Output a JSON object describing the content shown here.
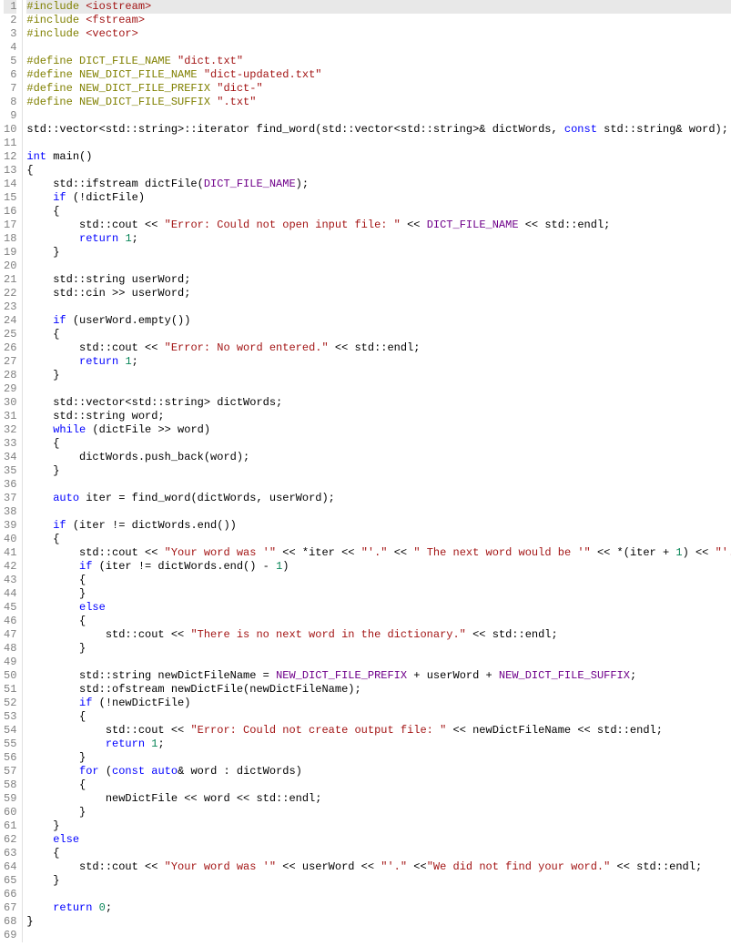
{
  "editor": {
    "highlighted_line": 1,
    "total_lines": 69,
    "lines": [
      {
        "n": 1,
        "tokens": [
          [
            "pp",
            "#include "
          ],
          [
            "str",
            "<iostream>"
          ]
        ]
      },
      {
        "n": 2,
        "tokens": [
          [
            "pp",
            "#include "
          ],
          [
            "str",
            "<fstream>"
          ]
        ]
      },
      {
        "n": 3,
        "tokens": [
          [
            "pp",
            "#include "
          ],
          [
            "str",
            "<vector>"
          ]
        ]
      },
      {
        "n": 4,
        "tokens": []
      },
      {
        "n": 5,
        "tokens": [
          [
            "pp",
            "#define DICT_FILE_NAME "
          ],
          [
            "str",
            "\"dict.txt\""
          ]
        ]
      },
      {
        "n": 6,
        "tokens": [
          [
            "pp",
            "#define NEW_DICT_FILE_NAME "
          ],
          [
            "str",
            "\"dict-updated.txt\""
          ]
        ]
      },
      {
        "n": 7,
        "tokens": [
          [
            "pp",
            "#define NEW_DICT_FILE_PREFIX "
          ],
          [
            "str",
            "\"dict-\""
          ]
        ]
      },
      {
        "n": 8,
        "tokens": [
          [
            "pp",
            "#define NEW_DICT_FILE_SUFFIX "
          ],
          [
            "str",
            "\".txt\""
          ]
        ]
      },
      {
        "n": 9,
        "tokens": []
      },
      {
        "n": 10,
        "tokens": [
          [
            "id",
            "std::vector<std::string>::iterator find_word(std::vector<std::string>& dictWords, "
          ],
          [
            "kw",
            "const"
          ],
          [
            "id",
            " std::string& word);"
          ]
        ]
      },
      {
        "n": 11,
        "tokens": []
      },
      {
        "n": 12,
        "tokens": [
          [
            "kw",
            "int"
          ],
          [
            "id",
            " main()"
          ]
        ]
      },
      {
        "n": 13,
        "tokens": [
          [
            "id",
            "{"
          ]
        ]
      },
      {
        "n": 14,
        "tokens": [
          [
            "id",
            "    std::ifstream dictFile("
          ],
          [
            "mac",
            "DICT_FILE_NAME"
          ],
          [
            "id",
            ");"
          ]
        ]
      },
      {
        "n": 15,
        "tokens": [
          [
            "id",
            "    "
          ],
          [
            "kw",
            "if"
          ],
          [
            "id",
            " (!dictFile)"
          ]
        ]
      },
      {
        "n": 16,
        "tokens": [
          [
            "id",
            "    {"
          ]
        ]
      },
      {
        "n": 17,
        "tokens": [
          [
            "id",
            "        std::cout << "
          ],
          [
            "str",
            "\"Error: Could not open input file: \""
          ],
          [
            "id",
            " << "
          ],
          [
            "mac",
            "DICT_FILE_NAME"
          ],
          [
            "id",
            " << std::endl;"
          ]
        ]
      },
      {
        "n": 18,
        "tokens": [
          [
            "id",
            "        "
          ],
          [
            "kw",
            "return"
          ],
          [
            "id",
            " "
          ],
          [
            "num",
            "1"
          ],
          [
            "id",
            ";"
          ]
        ]
      },
      {
        "n": 19,
        "tokens": [
          [
            "id",
            "    }"
          ]
        ]
      },
      {
        "n": 20,
        "tokens": []
      },
      {
        "n": 21,
        "tokens": [
          [
            "id",
            "    std::string userWord;"
          ]
        ]
      },
      {
        "n": 22,
        "tokens": [
          [
            "id",
            "    std::cin >> userWord;"
          ]
        ]
      },
      {
        "n": 23,
        "tokens": []
      },
      {
        "n": 24,
        "tokens": [
          [
            "id",
            "    "
          ],
          [
            "kw",
            "if"
          ],
          [
            "id",
            " (userWord.empty())"
          ]
        ]
      },
      {
        "n": 25,
        "tokens": [
          [
            "id",
            "    {"
          ]
        ]
      },
      {
        "n": 26,
        "tokens": [
          [
            "id",
            "        std::cout << "
          ],
          [
            "str",
            "\"Error: No word entered.\""
          ],
          [
            "id",
            " << std::endl;"
          ]
        ]
      },
      {
        "n": 27,
        "tokens": [
          [
            "id",
            "        "
          ],
          [
            "kw",
            "return"
          ],
          [
            "id",
            " "
          ],
          [
            "num",
            "1"
          ],
          [
            "id",
            ";"
          ]
        ]
      },
      {
        "n": 28,
        "tokens": [
          [
            "id",
            "    }"
          ]
        ]
      },
      {
        "n": 29,
        "tokens": []
      },
      {
        "n": 30,
        "tokens": [
          [
            "id",
            "    std::vector<std::string> dictWords;"
          ]
        ]
      },
      {
        "n": 31,
        "tokens": [
          [
            "id",
            "    std::string word;"
          ]
        ]
      },
      {
        "n": 32,
        "tokens": [
          [
            "id",
            "    "
          ],
          [
            "kw",
            "while"
          ],
          [
            "id",
            " (dictFile >> word)"
          ]
        ]
      },
      {
        "n": 33,
        "tokens": [
          [
            "id",
            "    {"
          ]
        ]
      },
      {
        "n": 34,
        "tokens": [
          [
            "id",
            "        dictWords.push_back(word);"
          ]
        ]
      },
      {
        "n": 35,
        "tokens": [
          [
            "id",
            "    }"
          ]
        ]
      },
      {
        "n": 36,
        "tokens": []
      },
      {
        "n": 37,
        "tokens": [
          [
            "id",
            "    "
          ],
          [
            "kw",
            "auto"
          ],
          [
            "id",
            " iter = find_word(dictWords, userWord);"
          ]
        ]
      },
      {
        "n": 38,
        "tokens": []
      },
      {
        "n": 39,
        "tokens": [
          [
            "id",
            "    "
          ],
          [
            "kw",
            "if"
          ],
          [
            "id",
            " (iter != dictWords.end())"
          ]
        ]
      },
      {
        "n": 40,
        "tokens": [
          [
            "id",
            "    {"
          ]
        ]
      },
      {
        "n": 41,
        "tokens": [
          [
            "id",
            "        std::cout << "
          ],
          [
            "str",
            "\"Your word was '\""
          ],
          [
            "id",
            " << *iter << "
          ],
          [
            "str",
            "\"'.\""
          ],
          [
            "id",
            " << "
          ],
          [
            "str",
            "\" The next word would be '\""
          ],
          [
            "id",
            " << *(iter + "
          ],
          [
            "num",
            "1"
          ],
          [
            "id",
            ") << "
          ],
          [
            "str",
            "\"'.\""
          ],
          [
            "id",
            "<< "
          ]
        ]
      },
      {
        "n": 42,
        "tokens": [
          [
            "id",
            "        "
          ],
          [
            "kw",
            "if"
          ],
          [
            "id",
            " (iter != dictWords.end() - "
          ],
          [
            "num",
            "1"
          ],
          [
            "id",
            ")"
          ]
        ]
      },
      {
        "n": 43,
        "tokens": [
          [
            "id",
            "        {"
          ]
        ]
      },
      {
        "n": 44,
        "tokens": [
          [
            "id",
            "        }"
          ]
        ]
      },
      {
        "n": 45,
        "tokens": [
          [
            "id",
            "        "
          ],
          [
            "kw",
            "else"
          ]
        ]
      },
      {
        "n": 46,
        "tokens": [
          [
            "id",
            "        {"
          ]
        ]
      },
      {
        "n": 47,
        "tokens": [
          [
            "id",
            "            std::cout << "
          ],
          [
            "str",
            "\"There is no next word in the dictionary.\""
          ],
          [
            "id",
            " << std::endl;"
          ]
        ]
      },
      {
        "n": 48,
        "tokens": [
          [
            "id",
            "        }"
          ]
        ]
      },
      {
        "n": 49,
        "tokens": []
      },
      {
        "n": 50,
        "tokens": [
          [
            "id",
            "        std::string newDictFileName = "
          ],
          [
            "mac",
            "NEW_DICT_FILE_PREFIX"
          ],
          [
            "id",
            " + userWord + "
          ],
          [
            "mac",
            "NEW_DICT_FILE_SUFFIX"
          ],
          [
            "id",
            ";"
          ]
        ]
      },
      {
        "n": 51,
        "tokens": [
          [
            "id",
            "        std::ofstream newDictFile(newDictFileName);"
          ]
        ]
      },
      {
        "n": 52,
        "tokens": [
          [
            "id",
            "        "
          ],
          [
            "kw",
            "if"
          ],
          [
            "id",
            " (!newDictFile)"
          ]
        ]
      },
      {
        "n": 53,
        "tokens": [
          [
            "id",
            "        {"
          ]
        ]
      },
      {
        "n": 54,
        "tokens": [
          [
            "id",
            "            std::cout << "
          ],
          [
            "str",
            "\"Error: Could not create output file: \""
          ],
          [
            "id",
            " << newDictFileName << std::endl;"
          ]
        ]
      },
      {
        "n": 55,
        "tokens": [
          [
            "id",
            "            "
          ],
          [
            "kw",
            "return"
          ],
          [
            "id",
            " "
          ],
          [
            "num",
            "1"
          ],
          [
            "id",
            ";"
          ]
        ]
      },
      {
        "n": 56,
        "tokens": [
          [
            "id",
            "        }"
          ]
        ]
      },
      {
        "n": 57,
        "tokens": [
          [
            "id",
            "        "
          ],
          [
            "kw",
            "for"
          ],
          [
            "id",
            " ("
          ],
          [
            "kw",
            "const"
          ],
          [
            "id",
            " "
          ],
          [
            "kw",
            "auto"
          ],
          [
            "id",
            "& word : dictWords)"
          ]
        ]
      },
      {
        "n": 58,
        "tokens": [
          [
            "id",
            "        {"
          ]
        ]
      },
      {
        "n": 59,
        "tokens": [
          [
            "id",
            "            newDictFile << word << std::endl;"
          ]
        ]
      },
      {
        "n": 60,
        "tokens": [
          [
            "id",
            "        }"
          ]
        ]
      },
      {
        "n": 61,
        "tokens": [
          [
            "id",
            "    }"
          ]
        ]
      },
      {
        "n": 62,
        "tokens": [
          [
            "id",
            "    "
          ],
          [
            "kw",
            "else"
          ]
        ]
      },
      {
        "n": 63,
        "tokens": [
          [
            "id",
            "    {"
          ]
        ]
      },
      {
        "n": 64,
        "tokens": [
          [
            "id",
            "        std::cout << "
          ],
          [
            "str",
            "\"Your word was '\""
          ],
          [
            "id",
            " << userWord << "
          ],
          [
            "str",
            "\"'.\""
          ],
          [
            "id",
            " <<"
          ],
          [
            "str",
            "\"We did not find your word.\""
          ],
          [
            "id",
            " << std::endl;"
          ]
        ]
      },
      {
        "n": 65,
        "tokens": [
          [
            "id",
            "    }"
          ]
        ]
      },
      {
        "n": 66,
        "tokens": []
      },
      {
        "n": 67,
        "tokens": [
          [
            "id",
            "    "
          ],
          [
            "kw",
            "return"
          ],
          [
            "id",
            " "
          ],
          [
            "num",
            "0"
          ],
          [
            "id",
            ";"
          ]
        ]
      },
      {
        "n": 68,
        "tokens": [
          [
            "id",
            "}"
          ]
        ]
      },
      {
        "n": 69,
        "tokens": []
      }
    ]
  }
}
